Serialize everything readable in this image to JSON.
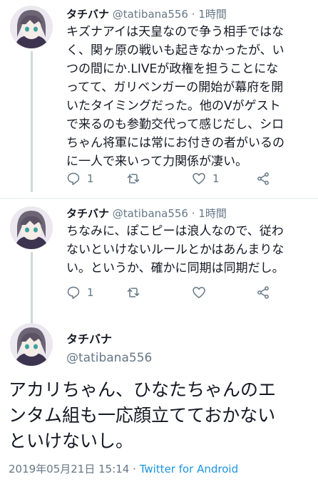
{
  "tweets": [
    {
      "name": "タチバナ",
      "handle": "@tatibana556",
      "dot": "·",
      "time": "1時間",
      "lines": [
        "キズナアイは天皇なので争う相手ではな",
        "く、関ヶ原の戦いも起きなかったが、い",
        "つの間にか.LIVEが政権を担うことにな",
        "ってて、ガリベンガーの開始が幕府を開",
        "いたタイミングだった。他のVがゲスト",
        "で来るのも参勤交代って感じだし、シロ",
        "ちゃん将軍には常にお付きの者がいるの",
        "に一人で来いって力関係が凄い。"
      ],
      "reply_count": "1",
      "retweet_count": "",
      "like_count": "1"
    },
    {
      "name": "タチバナ",
      "handle": "@tatibana556",
      "dot": "·",
      "time": "1時間",
      "lines": [
        "ちなみに、ぽこピーは浪人なので、従わ",
        "ないといけないルールとかはあんまりな",
        "い。というか、確かに同期は同期だし。"
      ],
      "reply_count": "1",
      "retweet_count": "",
      "like_count": ""
    }
  ],
  "main": {
    "name": "タチバナ",
    "handle": "@tatibana556",
    "lines": [
      "アカリちゃん、ひなたちゃんのエ",
      "ンタム組も一応顔立てておかない",
      "といけないし。"
    ],
    "timestamp": "2019年05月21日 15:14",
    "separator": "·",
    "client": "Twitter for Android"
  },
  "icons": [
    "avatar",
    "reply-icon",
    "retweet-icon",
    "like-icon",
    "share-icon"
  ],
  "colors": {
    "secondary_text": "#657786",
    "link": "#1b95e0",
    "thread_line": "#cfd9de"
  }
}
